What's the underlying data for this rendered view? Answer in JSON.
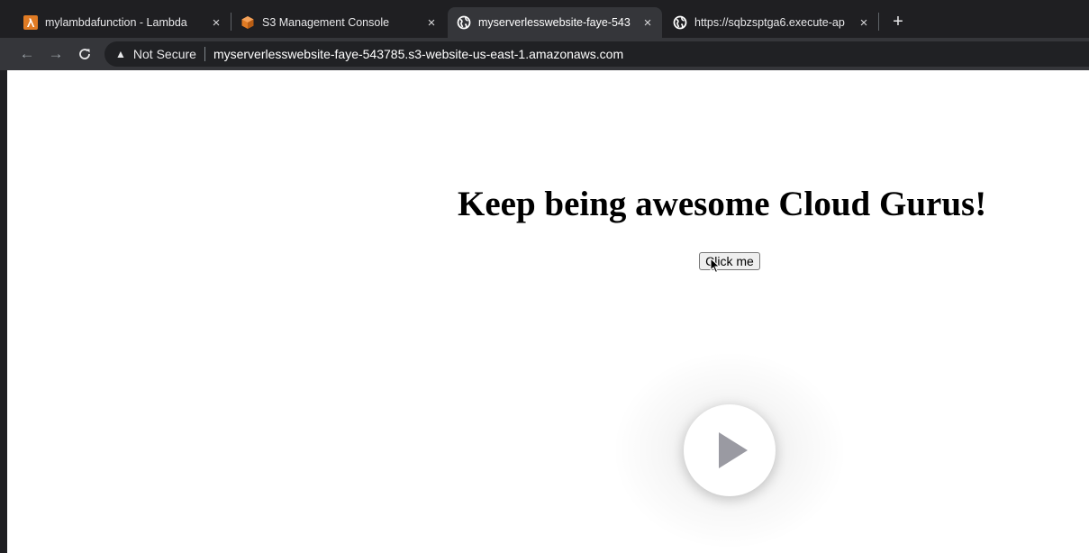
{
  "browser": {
    "tabs": [
      {
        "title": "mylambdafunction - Lambda",
        "icon": "lambda-icon",
        "active": false
      },
      {
        "title": "S3 Management Console",
        "icon": "s3-bucket-icon",
        "active": false
      },
      {
        "title": "myserverlesswebsite-faye-543",
        "icon": "globe-icon",
        "active": true
      },
      {
        "title": "https://sqbzsptga6.execute-ap",
        "icon": "globe-icon",
        "active": false
      }
    ],
    "close_glyph": "×",
    "new_tab_glyph": "+",
    "toolbar": {
      "back_glyph": "←",
      "forward_glyph": "→",
      "reload_glyph": "C",
      "security_label": "Not Secure",
      "url": "myserverlesswebsite-faye-543785.s3-website-us-east-1.amazonaws.com"
    }
  },
  "page": {
    "headline": "Keep being awesome Cloud Gurus!",
    "button_label": "Click me"
  },
  "colors": {
    "lambda_icon": "#e07b24",
    "s3_icon": "#e07b24",
    "play_triangle": "#9a9aa2"
  }
}
